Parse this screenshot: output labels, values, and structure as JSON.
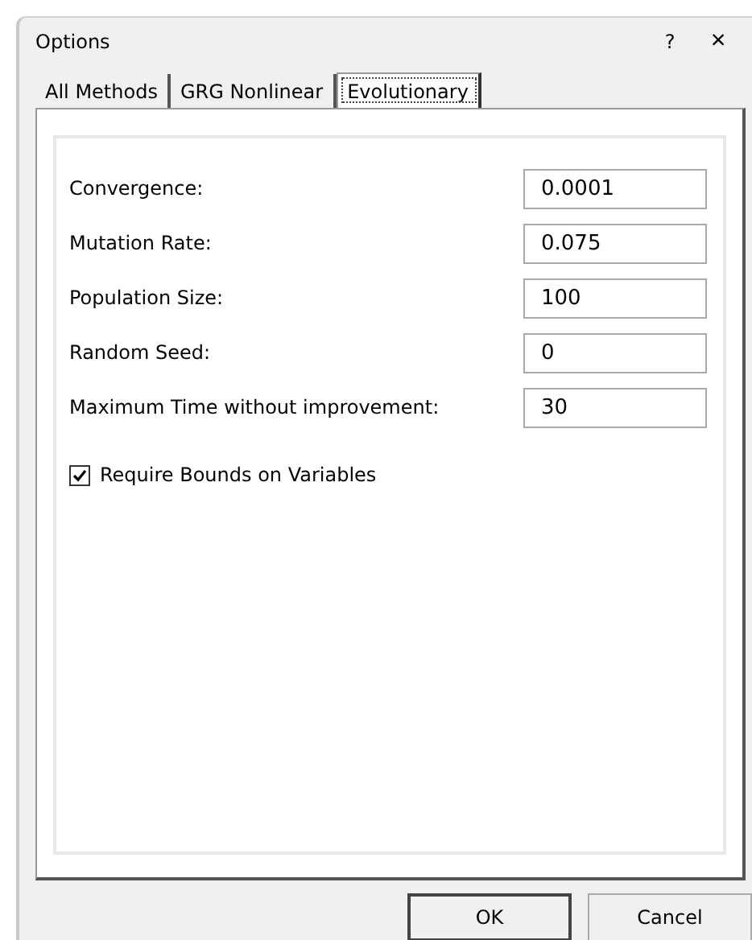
{
  "window": {
    "title": "Options",
    "help": "?",
    "close": "×"
  },
  "tabs": [
    {
      "label": "All Methods",
      "selected": false
    },
    {
      "label": "GRG Nonlinear",
      "selected": false
    },
    {
      "label": "Evolutionary",
      "selected": true
    }
  ],
  "fields": [
    {
      "label": "Convergence:",
      "value": "0.0001"
    },
    {
      "label": "Mutation Rate:",
      "value": "0.075"
    },
    {
      "label": "Population Size:",
      "value": "100"
    },
    {
      "label": "Random Seed:",
      "value": "0"
    },
    {
      "label": "Maximum Time without improvement:",
      "value": "30"
    }
  ],
  "checkbox": {
    "label": "Require Bounds on Variables",
    "checked": true
  },
  "buttons": [
    {
      "label": "OK",
      "default": true
    },
    {
      "label": "Cancel",
      "default": false
    }
  ]
}
